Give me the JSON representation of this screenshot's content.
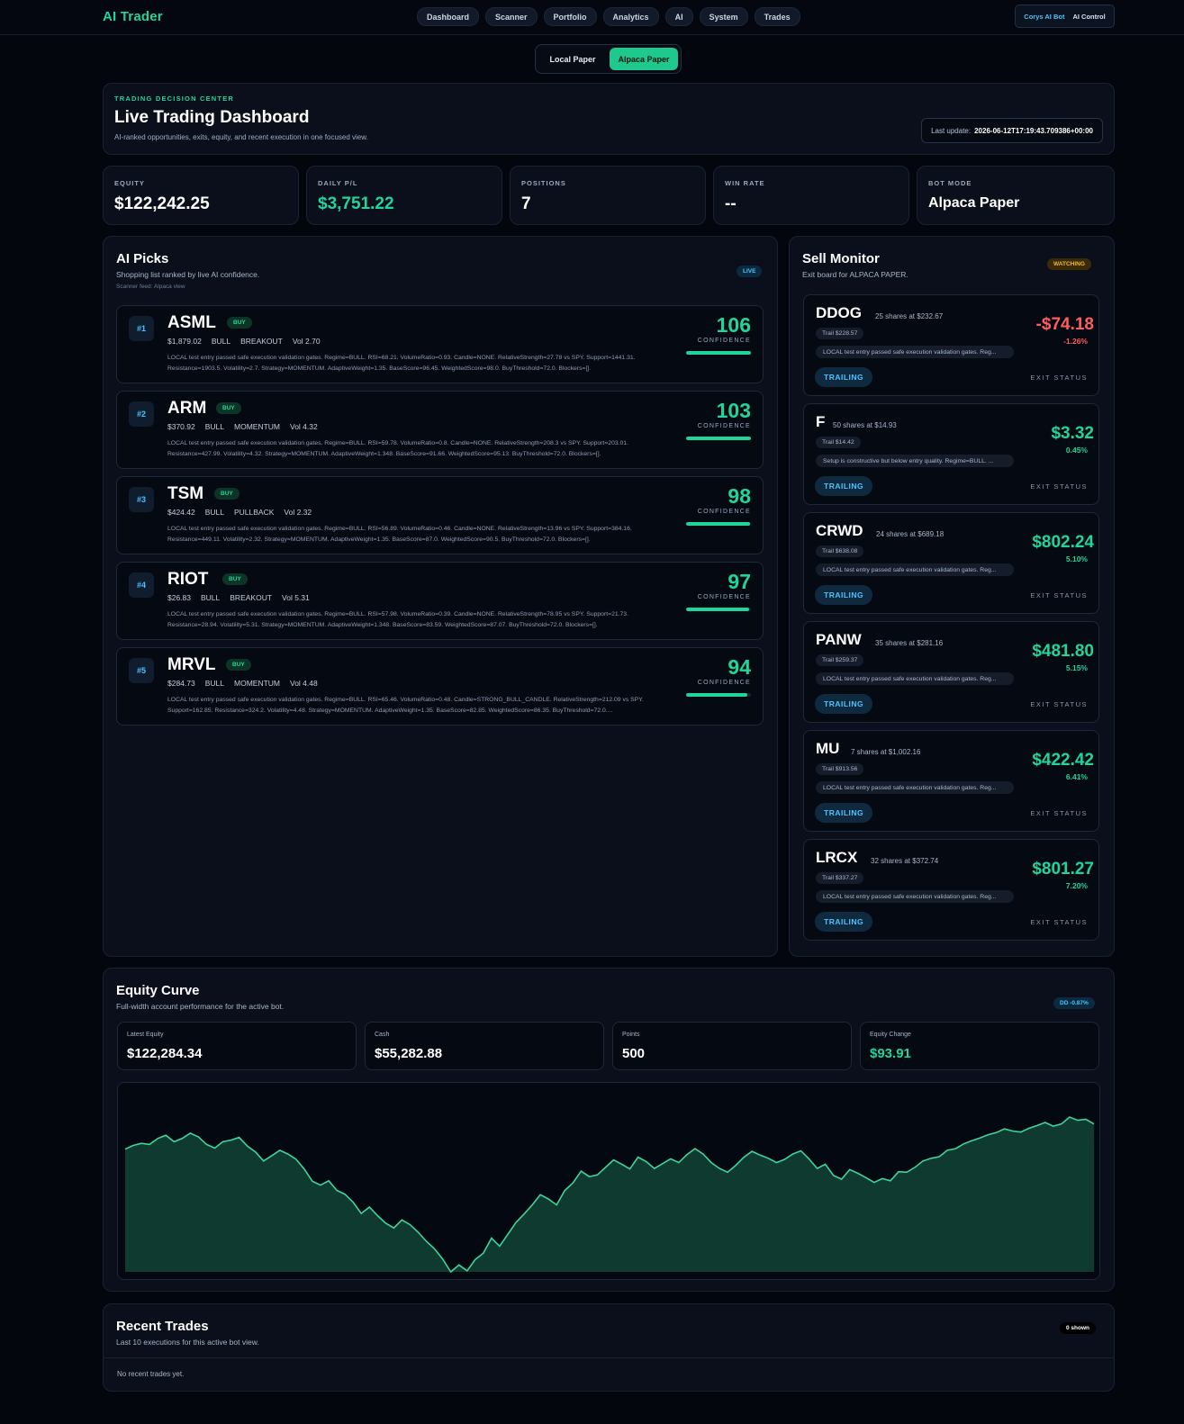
{
  "app": {
    "brand": "AI Trader"
  },
  "nav": [
    "Dashboard",
    "Scanner",
    "Portfolio",
    "Analytics",
    "AI",
    "System",
    "Trades"
  ],
  "bot_switch": {
    "primary": "Corys AI Bot",
    "secondary": "AI Control"
  },
  "mode_toggle": {
    "options": [
      "Local Paper",
      "Alpaca Paper"
    ],
    "active": "Alpaca Paper"
  },
  "hero": {
    "eyebrow": "TRADING DECISION CENTER",
    "title": "Live Trading Dashboard",
    "subtitle": "AI-ranked opportunities, exits, equity, and recent execution in one focused view.",
    "last_update_label": "Last update:",
    "last_update_value": "2026-06-12T17:19:43.709386+00:00"
  },
  "stats": [
    {
      "label": "EQUITY",
      "value": "$122,242.25"
    },
    {
      "label": "DAILY P/L",
      "value": "$3,751.22"
    },
    {
      "label": "POSITIONS",
      "value": "7"
    },
    {
      "label": "WIN RATE",
      "value": "--"
    },
    {
      "label": "BOT MODE",
      "value": "Alpaca Paper"
    }
  ],
  "ai_picks": {
    "title": "AI Picks",
    "subtitle": "Shopping list ranked by live AI confidence.",
    "feed": "Scanner feed: Alpaca view",
    "badge": "LIVE",
    "confidence_label": "CONFIDENCE",
    "items": [
      {
        "rank": "#1",
        "ticker": "ASML",
        "action": "BUY",
        "price": "$1,879.02",
        "regime": "BULL",
        "setup": "BREAKOUT",
        "vol": "Vol 2.70",
        "confidence": 106,
        "bar_fill": 1.0,
        "reason": "LOCAL test entry passed safe execution validation gates. Regime=BULL. RSI=68.21. VolumeRatio=0.93. Candle=NONE. RelativeStrength=27.78 vs SPY. Support=1441.31. Resistance=1903.5. Volatility=2.7. Strategy=MOMENTUM. AdaptiveWeight=1.35. BaseScore=96.45. WeightedScore=98.0. BuyThreshold=72.0. Blockers=[]."
      },
      {
        "rank": "#2",
        "ticker": "ARM",
        "action": "BUY",
        "price": "$370.92",
        "regime": "BULL",
        "setup": "MOMENTUM",
        "vol": "Vol 4.32",
        "confidence": 103,
        "bar_fill": 1.0,
        "reason": "LOCAL test entry passed safe execution validation gates. Regime=BULL. RSI=59.78. VolumeRatio=0.8. Candle=NONE. RelativeStrength=208.3 vs SPY. Support=203.01. Resistance=427.99. Volatility=4.32. Strategy=MOMENTUM. AdaptiveWeight=1.348. BaseScore=91.66. WeightedScore=95.13. BuyThreshold=72.0. Blockers=[]."
      },
      {
        "rank": "#3",
        "ticker": "TSM",
        "action": "BUY",
        "price": "$424.42",
        "regime": "BULL",
        "setup": "PULLBACK",
        "vol": "Vol 2.32",
        "confidence": 98,
        "bar_fill": 0.98,
        "reason": "LOCAL test entry passed safe execution validation gates. Regime=BULL. RSI=56.89. VolumeRatio=0.46. Candle=NONE. RelativeStrength=13.96 vs SPY. Support=384.16. Resistance=449.11. Volatility=2.32. Strategy=MOMENTUM. AdaptiveWeight=1.35. BaseScore=87.0. WeightedScore=90.5. BuyThreshold=72.0. Blockers=[]."
      },
      {
        "rank": "#4",
        "ticker": "RIOT",
        "action": "BUY",
        "price": "$26.83",
        "regime": "BULL",
        "setup": "BREAKOUT",
        "vol": "Vol 5.31",
        "confidence": 97,
        "bar_fill": 0.97,
        "reason": "LOCAL test entry passed safe execution validation gates. Regime=BULL. RSI=57.98. VolumeRatio=0.39. Candle=NONE. RelativeStrength=78.95 vs SPY. Support=21.73. Resistance=28.94. Volatility=5.31. Strategy=MOMENTUM. AdaptiveWeight=1.348. BaseScore=83.59. WeightedScore=87.07. BuyThreshold=72.0. Blockers=[]."
      },
      {
        "rank": "#5",
        "ticker": "MRVL",
        "action": "BUY",
        "price": "$284.73",
        "regime": "BULL",
        "setup": "MOMENTUM",
        "vol": "Vol 4.48",
        "confidence": 94,
        "bar_fill": 0.94,
        "reason": "LOCAL test entry passed safe execution validation gates. Regime=BULL. RSI=65.46. VolumeRatio=0.48. Candle=STRONG_BULL_CANDLE. RelativeStrength=212.09 vs SPY. Support=162.85. Resistance=324.2. Volatility=4.48. Strategy=MOMENTUM. AdaptiveWeight=1.35. BaseScore=82.85. WeightedScore=86.35. BuyThreshold=72.0...."
      }
    ]
  },
  "sell_monitor": {
    "title": "Sell Monitor",
    "subtitle": "Exit board for ALPACA PAPER.",
    "badge": "WATCHING",
    "status_label": "TRAILING",
    "exit_label": "EXIT STATUS",
    "items": [
      {
        "ticker": "DDOG",
        "shares": "25 shares at $232.67",
        "trail": "Trail $228.57",
        "note": "LOCAL test entry passed safe execution validation gates. Reg...",
        "pnl": "-$74.18",
        "pct": "-1.26%",
        "direction": "down"
      },
      {
        "ticker": "F",
        "shares": "50 shares at $14.93",
        "trail": "Trail $14.42",
        "note": "Setup is constructive but below entry quality. Regime=BULL. ...",
        "pnl": "$3.32",
        "pct": "0.45%",
        "direction": "up"
      },
      {
        "ticker": "CRWD",
        "shares": "24 shares at $689.18",
        "trail": "Trail $638.08",
        "note": "LOCAL test entry passed safe execution validation gates. Reg...",
        "pnl": "$802.24",
        "pct": "5.10%",
        "direction": "up"
      },
      {
        "ticker": "PANW",
        "shares": "35 shares at $281.16",
        "trail": "Trail $259.37",
        "note": "LOCAL test entry passed safe execution validation gates. Reg...",
        "pnl": "$481.80",
        "pct": "5.15%",
        "direction": "up"
      },
      {
        "ticker": "MU",
        "shares": "7 shares at $1,002.16",
        "trail": "Trail $913.56",
        "note": "LOCAL test entry passed safe execution validation gates. Reg...",
        "pnl": "$422.42",
        "pct": "6.41%",
        "direction": "up"
      },
      {
        "ticker": "LRCX",
        "shares": "32 shares at $372.74",
        "trail": "Trail $337.27",
        "note": "LOCAL test entry passed safe execution validation gates. Reg...",
        "pnl": "$801.27",
        "pct": "7.20%",
        "direction": "up"
      }
    ]
  },
  "equity_curve": {
    "title": "Equity Curve",
    "subtitle": "Full-width account performance for the active bot.",
    "badge": "DD -0.87%",
    "cards": [
      {
        "label": "Latest Equity",
        "value": "$122,284.34"
      },
      {
        "label": "Cash",
        "value": "$55,282.88"
      },
      {
        "label": "Points",
        "value": "500"
      },
      {
        "label": "Equity Change",
        "value": "$93.91"
      }
    ],
    "colors": {
      "line": "#3fd49b",
      "fill": "#0f3a2f"
    }
  },
  "chart_data": {
    "type": "area",
    "title": "",
    "xlabel": "",
    "ylabel": "",
    "points_count": 500,
    "grid": false,
    "series": [
      {
        "values": [
          122190,
          122197,
          122201,
          122199,
          122210,
          122216,
          122204,
          122210,
          122220,
          122213,
          122199,
          122192,
          122204,
          122207,
          122212,
          122196,
          122185,
          122168,
          122178,
          122188,
          122181,
          122171,
          122153,
          122130,
          122123,
          122131,
          122113,
          122106,
          122091,
          122070,
          122082,
          122066,
          122052,
          122043,
          122058,
          122049,
          122035,
          122018,
          122004,
          121985,
          121961,
          121974,
          121963,
          121984,
          121996,
          122024,
          122009,
          122031,
          122053,
          122069,
          122086,
          122105,
          122097,
          122086,
          122113,
          122127,
          122149,
          122139,
          122142,
          122156,
          122170,
          122162,
          122153,
          122175,
          122167,
          122154,
          122163,
          122172,
          122165,
          122180,
          122191,
          122181,
          122165,
          122154,
          122147,
          122160,
          122175,
          122186,
          122179,
          122173,
          122165,
          122171,
          122181,
          122187,
          122172,
          122154,
          122162,
          122141,
          122134,
          122152,
          122145,
          122137,
          122128,
          122135,
          122131,
          122148,
          122147,
          122156,
          122168,
          122173,
          122176,
          122188,
          122191,
          122200,
          122206,
          122211,
          122217,
          122221,
          122228,
          122224,
          122222,
          122229,
          122234,
          122240,
          122233,
          122237,
          122250,
          122244,
          122246,
          122237
        ]
      }
    ]
  },
  "recent_trades": {
    "title": "Recent Trades",
    "subtitle": "Last 10 executions for this active bot view.",
    "badge": "0 shown",
    "empty": "No recent trades yet."
  }
}
